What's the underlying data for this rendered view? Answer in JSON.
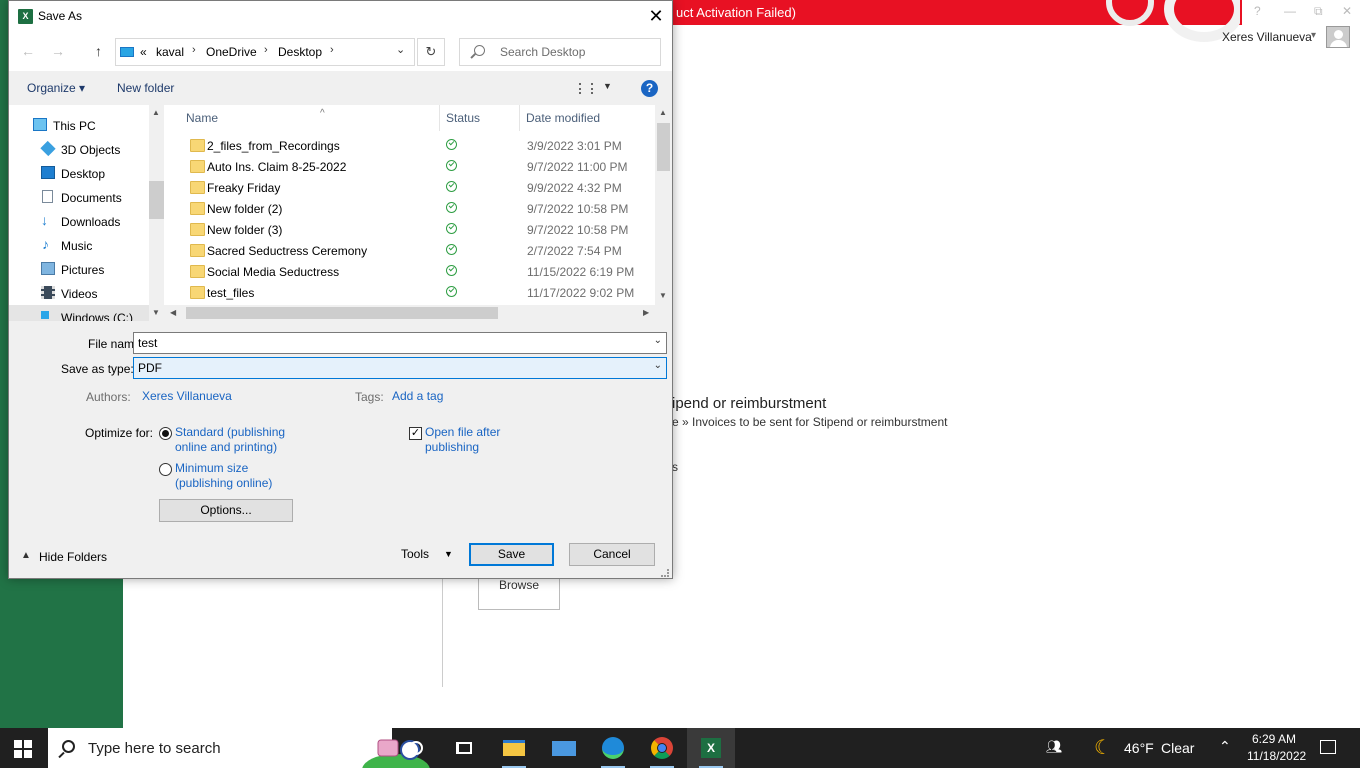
{
  "background": {
    "error_banner": "uct Activation Failed)",
    "user_name": "Xeres Villanueva",
    "heading": "ipend or reimburstment",
    "path": "e » Invoices to be sent for Stipend or reimburstment",
    "fragment": "s",
    "browse_label": "Browse",
    "window_buttons": [
      "?",
      "—",
      "⧉",
      "✕"
    ]
  },
  "dialog": {
    "title": "Save As",
    "app_icon": "excel-icon",
    "close_glyph": "✕",
    "address_crumbs": [
      "«",
      "kaval",
      "OneDrive",
      "Desktop"
    ],
    "search_placeholder": "Search Desktop",
    "organize_label": "Organize ▾",
    "new_folder_label": "New folder",
    "help_glyph": "?",
    "nav_items": [
      {
        "label": "This PC",
        "icon": "pc-icon"
      },
      {
        "label": "3D Objects",
        "icon": "cube-icon"
      },
      {
        "label": "Desktop",
        "icon": "desktop-icon"
      },
      {
        "label": "Documents",
        "icon": "documents-icon"
      },
      {
        "label": "Downloads",
        "icon": "download-icon"
      },
      {
        "label": "Music",
        "icon": "music-icon"
      },
      {
        "label": "Pictures",
        "icon": "pictures-icon"
      },
      {
        "label": "Videos",
        "icon": "videos-icon"
      },
      {
        "label": "Windows (C:)",
        "icon": "drive-icon"
      }
    ],
    "columns": [
      "Name",
      "Status",
      "Date modified"
    ],
    "files": [
      {
        "name": "2_files_from_Recordings",
        "date": "3/9/2022 3:01 PM"
      },
      {
        "name": "Auto Ins. Claim 8-25-2022",
        "date": "9/7/2022 11:00 PM"
      },
      {
        "name": "Freaky Friday",
        "date": "9/9/2022 4:32 PM"
      },
      {
        "name": "New folder (2)",
        "date": "9/7/2022 10:58 PM"
      },
      {
        "name": "New folder (3)",
        "date": "9/7/2022 10:58 PM"
      },
      {
        "name": "Sacred Seductress Ceremony",
        "date": "2/7/2022 7:54 PM"
      },
      {
        "name": "Social Media Seductress",
        "date": "11/15/2022 6:19 PM"
      },
      {
        "name": "test_files",
        "date": "11/17/2022 9:02 PM"
      }
    ],
    "file_name_label": "File name:",
    "file_name_value": "test",
    "save_type_label": "Save as type:",
    "save_type_value": "PDF",
    "authors_label": "Authors:",
    "authors_value": "Xeres Villanueva",
    "tags_label": "Tags:",
    "tags_value": "Add a tag",
    "optimize_label": "Optimize for:",
    "opt_standard_line1": "Standard (publishing",
    "opt_standard_line2": "online and printing)",
    "opt_minimum_line1": "Minimum size",
    "opt_minimum_line2": "(publishing online)",
    "open_after_line1": "Open file after",
    "open_after_line2": "publishing",
    "options_label": "Options...",
    "hide_folders_label": "Hide Folders",
    "tools_label": "Tools",
    "save_label": "Save",
    "cancel_label": "Cancel"
  },
  "taskbar": {
    "search_placeholder": "Type here to search",
    "temperature": "46°F",
    "weather": "Clear",
    "time": "6:29 AM",
    "date": "11/18/2022",
    "apps": [
      "task-view-icon",
      "cortana-icon",
      "file-explorer-icon",
      "mail-icon",
      "edge-icon",
      "chrome-icon",
      "excel-icon"
    ]
  },
  "colors": {
    "excel_green": "#217346",
    "banner_red": "#e81123",
    "accent_blue": "#0078d7",
    "link_blue": "#1a65c3",
    "taskbar": "#202020"
  }
}
